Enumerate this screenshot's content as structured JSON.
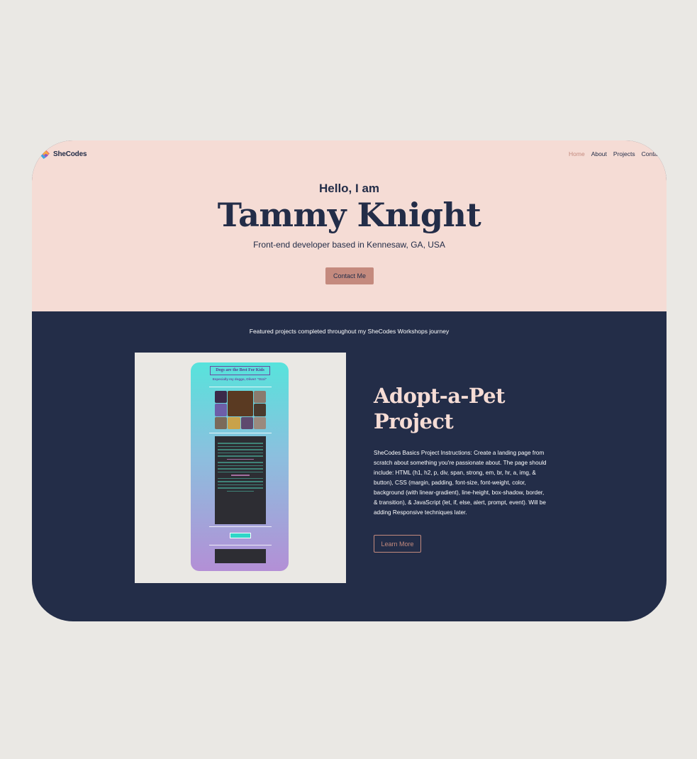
{
  "brand": {
    "name": "SheCodes",
    "icon": "shecodes-logo-icon"
  },
  "nav": {
    "items": [
      {
        "label": "Home",
        "active": true
      },
      {
        "label": "About",
        "active": false
      },
      {
        "label": "Projects",
        "active": false
      },
      {
        "label": "Contact",
        "active": false
      }
    ]
  },
  "hero": {
    "greeting": "Hello, I am",
    "name": "Tammy Knight",
    "subtitle": "Front-end developer based in Kennesaw, GA, USA",
    "contact_button": "Contact Me"
  },
  "projects": {
    "intro": "Featured projects completed throughout my SheCodes Workshops journey",
    "items": [
      {
        "title": "Adopt-a-Pet Project",
        "description": "SheCodes Basics Project Instructions: Create a landing page from scratch about something you're passionate about. The page should include: HTML (h1, h2, p, div, span, strong, em, br, hr, a, img, & button), CSS (margin, padding, font-size, font-weight, color, background (with linear-gradient), line-height, box-shadow, border, & transition), & JavaScript (let, if, else, alert, prompt, event). Will be adding Responsive techniques later.",
        "button": "Learn More",
        "preview": {
          "title": "Dogs are the Best For Kids",
          "subtitle": "Especially my doggo, Oliver! \"Ozzi\""
        }
      }
    ]
  },
  "colors": {
    "background": "#eae8e4",
    "hero": "#f5dcd5",
    "navy": "#232d48",
    "accent": "#c48a7e"
  }
}
